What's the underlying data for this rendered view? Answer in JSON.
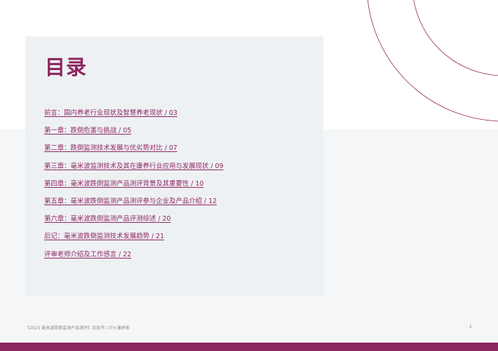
{
  "title": "目录",
  "toc": [
    "前言：国内养老行业现状及智慧养老现状 / 03",
    "第一章：跌倒危害与挑战 / 05",
    "第二章：跌倒监测技术发展与优劣势对比 / 07",
    "第三章：毫米波监测技术及其在康养行业应用与发展现状 / 09",
    "第四章：毫米波跌倒监测产品测评背景及其重要性 / 10",
    "第五章：毫米波跌倒监测产品测评参与企业及产品介绍 / 12",
    "第六章：毫米波跌倒监测产品评测综述 / 20",
    "后记：毫米波跌倒监测技术发展趋势 / 21",
    "评审老师介绍及工作感言 / 22"
  ],
  "footer": {
    "text": "《2023 毫米波跌倒监测产品测评》白皮书 | ITH 康养家",
    "page_number": "2"
  },
  "colors": {
    "accent": "#8e2562",
    "bottom_bar": "#8a2a60",
    "panel": "#eef1f3",
    "band": "#f4f6f7"
  }
}
